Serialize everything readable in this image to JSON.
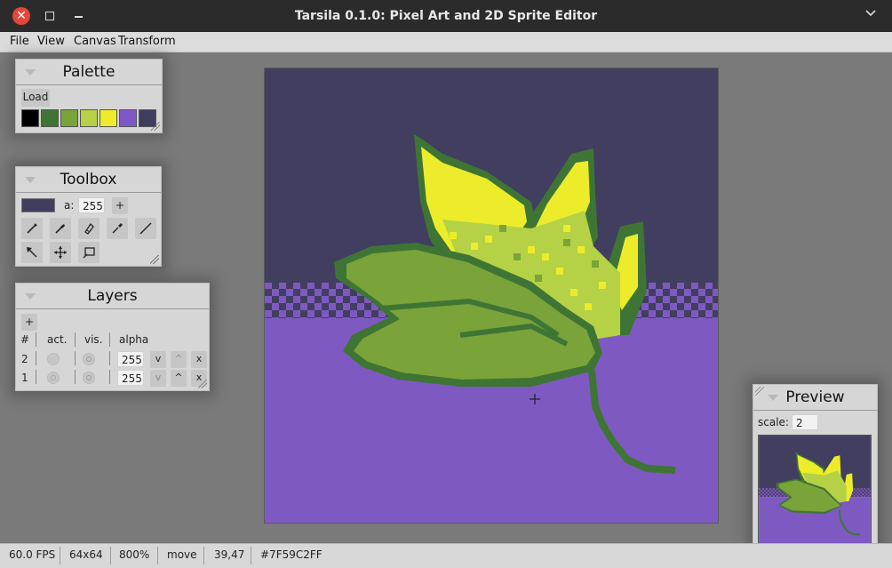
{
  "window": {
    "title": "Tarsila 0.1.0: Pixel Art and 2D Sprite Editor",
    "controls": [
      "close-icon",
      "maximize-icon",
      "minimize-icon",
      "chevron-down-icon"
    ]
  },
  "menu": [
    "File",
    "View",
    "Canvas",
    "Transform"
  ],
  "palette": {
    "title": "Palette",
    "load_label": "Load",
    "colors": [
      "#000000",
      "#3f7534",
      "#7aa33a",
      "#b5d146",
      "#ecec2a",
      "#8057c8",
      "#3f3d5e"
    ]
  },
  "toolbox": {
    "title": "Toolbox",
    "current_color": "#3f3d5e",
    "alpha_label": "a:",
    "alpha_value": "255",
    "plus_label": "+",
    "tools": [
      "pencil-icon",
      "brush-icon",
      "eraser-icon",
      "eyedropper-icon",
      "line-icon",
      "selection-arrow-icon",
      "move-icon",
      "rectangle-select-icon"
    ]
  },
  "layers": {
    "title": "Layers",
    "add_label": "+",
    "headers": {
      "num": "#",
      "active": "act.",
      "visible": "vis.",
      "alpha": "alpha"
    },
    "rows": [
      {
        "num": "2",
        "alpha": "255",
        "down": "v",
        "up": "^",
        "delete": "x",
        "active": true
      },
      {
        "num": "1",
        "alpha": "255",
        "down": "v",
        "up": "^",
        "delete": "x",
        "active": false
      }
    ]
  },
  "preview": {
    "title": "Preview",
    "scale_label": "scale:",
    "scale_value": "2"
  },
  "status": {
    "fps": "60.0 FPS",
    "size": "64x64",
    "zoom": "800%",
    "tool": "move",
    "cursor": "39,47",
    "color": "#7F59C2FF"
  },
  "colors": {
    "sky": "#413e5f",
    "ground": "#7f59c2",
    "leaf_dark": "#3f7534",
    "leaf_mid": "#7aa33a",
    "leaf_light": "#b5d146",
    "leaf_bright": "#ecec2a"
  }
}
